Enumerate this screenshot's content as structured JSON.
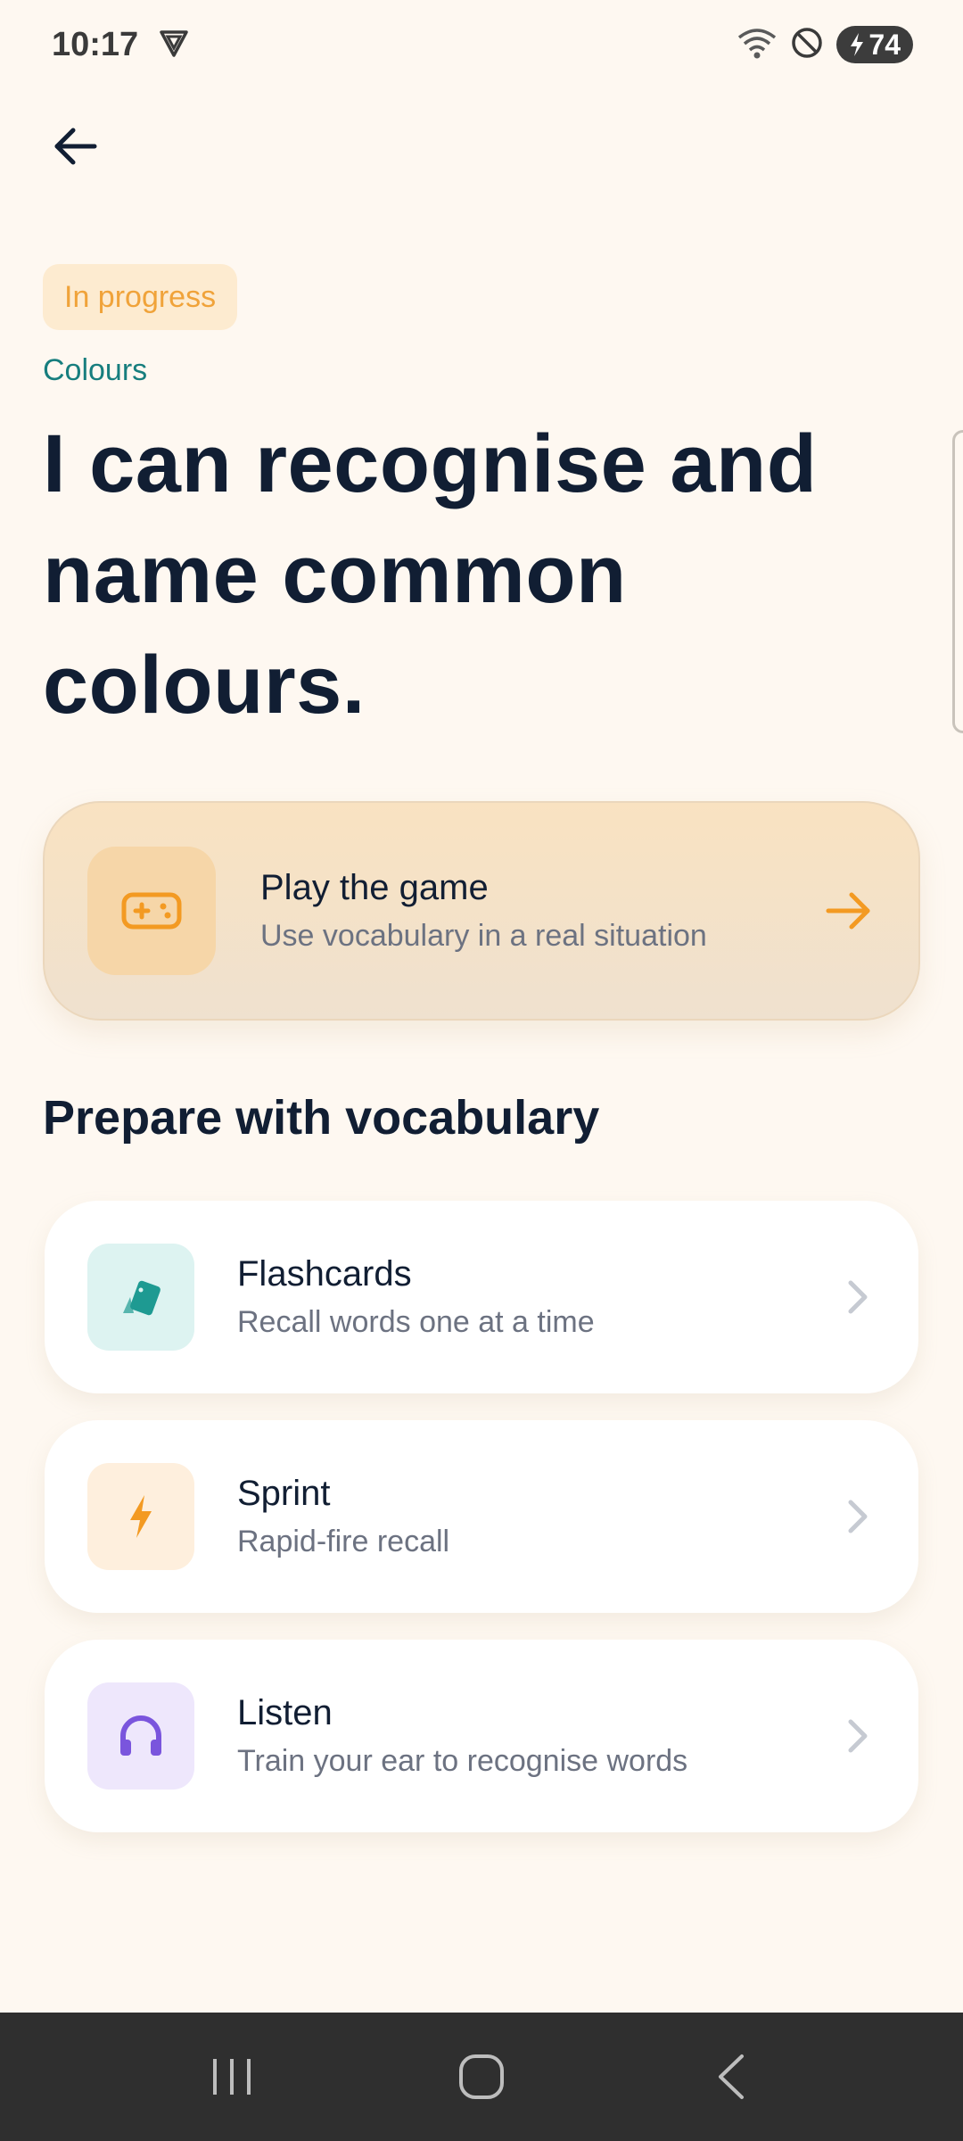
{
  "status_bar": {
    "time": "10:17",
    "battery": "74"
  },
  "header": {
    "badge": "In progress",
    "topic": "Colours",
    "headline": "I can recognise and name common colours."
  },
  "play_card": {
    "title": "Play the game",
    "subtitle": "Use vocabulary in a real situation",
    "icon": "gamepad-icon"
  },
  "section": {
    "title": "Prepare with vocabulary"
  },
  "activities": [
    {
      "title": "Flashcards",
      "subtitle": "Recall words one at a time",
      "icon": "cards-icon",
      "icon_bg": "#DDF3F1",
      "icon_color": "#1E9A92"
    },
    {
      "title": "Sprint",
      "subtitle": "Rapid-fire recall",
      "icon": "lightning-icon",
      "icon_bg": "#FEEFDD",
      "icon_color": "#F39A22"
    },
    {
      "title": "Listen",
      "subtitle": "Train your ear to recognise words",
      "icon": "headphones-icon",
      "icon_bg": "#EEE7FC",
      "icon_color": "#7A55DD"
    }
  ],
  "colors": {
    "background": "#FEF8F1",
    "accent": "#F39A22",
    "teal": "#177E7E",
    "heading": "#111E33"
  }
}
